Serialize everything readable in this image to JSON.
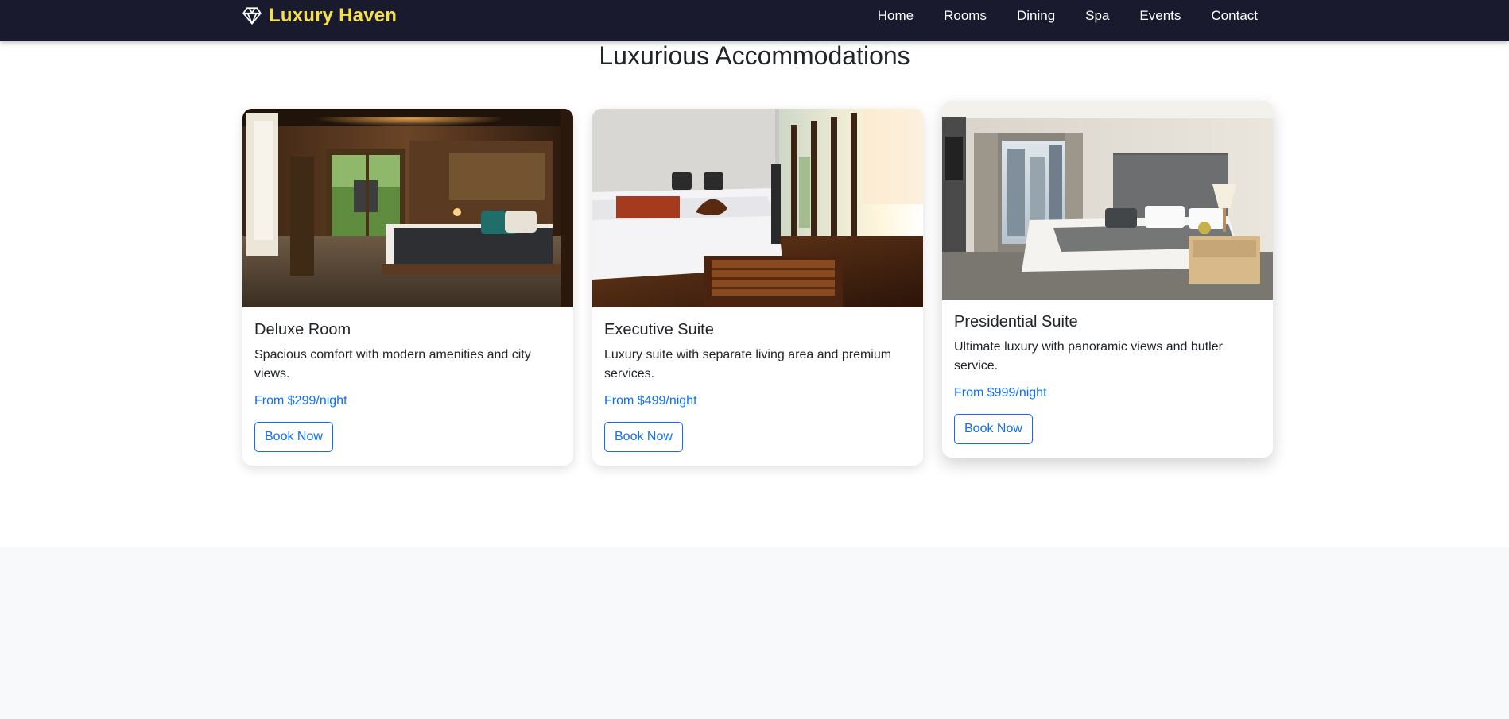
{
  "brand": {
    "name": "Luxury Haven",
    "icon": "gem-icon",
    "color": "#f4e04d"
  },
  "nav": [
    "Home",
    "Rooms",
    "Dining",
    "Spa",
    "Events",
    "Contact"
  ],
  "section": {
    "title": "Luxurious Accommodations"
  },
  "rooms": [
    {
      "name": "Deluxe Room",
      "description": "Spacious comfort with modern amenities and city views.",
      "price": "From $299/night",
      "button": "Book Now"
    },
    {
      "name": "Executive Suite",
      "description": "Luxury suite with separate living area and premium services.",
      "price": "From $499/night",
      "button": "Book Now"
    },
    {
      "name": "Presidential Suite",
      "description": "Ultimate luxury with panoramic views and butler service.",
      "price": "From $999/night",
      "button": "Book Now"
    }
  ],
  "colors": {
    "navbar": "#1a1a2e",
    "accent": "#0d6efd",
    "footer": "#f8f9fa"
  }
}
